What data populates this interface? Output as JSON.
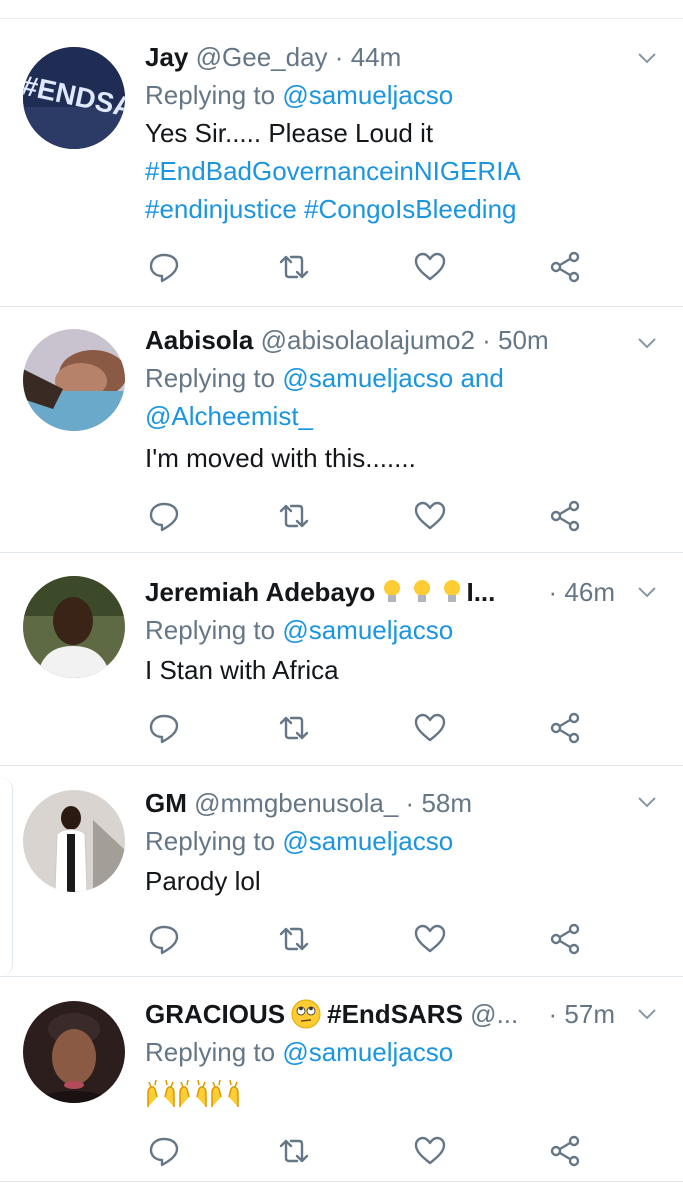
{
  "tweets": [
    {
      "name": "Jay",
      "handle": "@Gee_day",
      "sep": "·",
      "time": "44m",
      "replying_prefix": "Replying to ",
      "replying_to": "@samueljacso",
      "body_text": "Yes Sir..... Please Loud it",
      "hashtags_line1": "#EndBadGovernanceinNIGERIA",
      "hashtags_line2": "#endinjustice #CongoIsBleeding",
      "avatar_text": "#ENDSARS"
    },
    {
      "name": "Aabisola",
      "handle": "@abisolaolajumo2",
      "sep": "·",
      "time": "50m",
      "replying_prefix": "Replying to ",
      "replying_to": "@samueljacso",
      "replying_and": " and",
      "replying_to_2": "@Alcheemist_",
      "body_text": "I'm moved with this......."
    },
    {
      "name": "Jeremiah Adebayo",
      "name_suffix": "I...",
      "time": "· 46m",
      "replying_prefix": "Replying to ",
      "replying_to": "@samueljacso",
      "body_text": "I Stan with Africa"
    },
    {
      "name": "GM",
      "handle": "@mmgbenusola_",
      "sep": "·",
      "time": "58m",
      "replying_prefix": "Replying to ",
      "replying_to": "@samueljacso",
      "body_text": "Parody lol"
    },
    {
      "name": "GRACIOUS",
      "name_tag": "#EndSARS",
      "handle": "@...",
      "time": "· 57m",
      "replying_prefix": "Replying to ",
      "replying_to": "@samueljacso"
    }
  ],
  "icons": {
    "reply": "reply-icon",
    "retweet": "retweet-icon",
    "like": "heart-icon",
    "share": "share-icon",
    "more": "chevron-down-icon"
  },
  "colors": {
    "link": "#1b95e0",
    "secondary": "#657786",
    "divider": "#e1e8ed"
  }
}
